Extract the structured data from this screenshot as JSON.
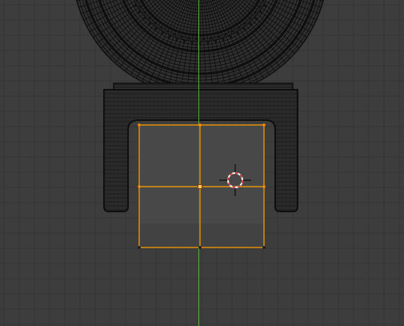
{
  "viewport": {
    "view": "front-orthographic",
    "mode": "edit-mode",
    "colors": {
      "background": "#3d3d3d",
      "grid_line": "#353535",
      "wire": "#0f0f0f",
      "selected_edge": "#ffa000",
      "selected_vertex": "#ff8a00",
      "y_axis": "#5fa83a",
      "cursor_ring_red": "#d23b3b",
      "cursor_ring_white": "#f2f2f2",
      "cursor_cross": "#111111"
    },
    "icons": {
      "cursor": "3d-cursor-icon",
      "vertex": "vertex-icon"
    },
    "selection": {
      "element": "face",
      "vertex_count": 9,
      "edge_count": 12,
      "face_count": 4
    }
  }
}
